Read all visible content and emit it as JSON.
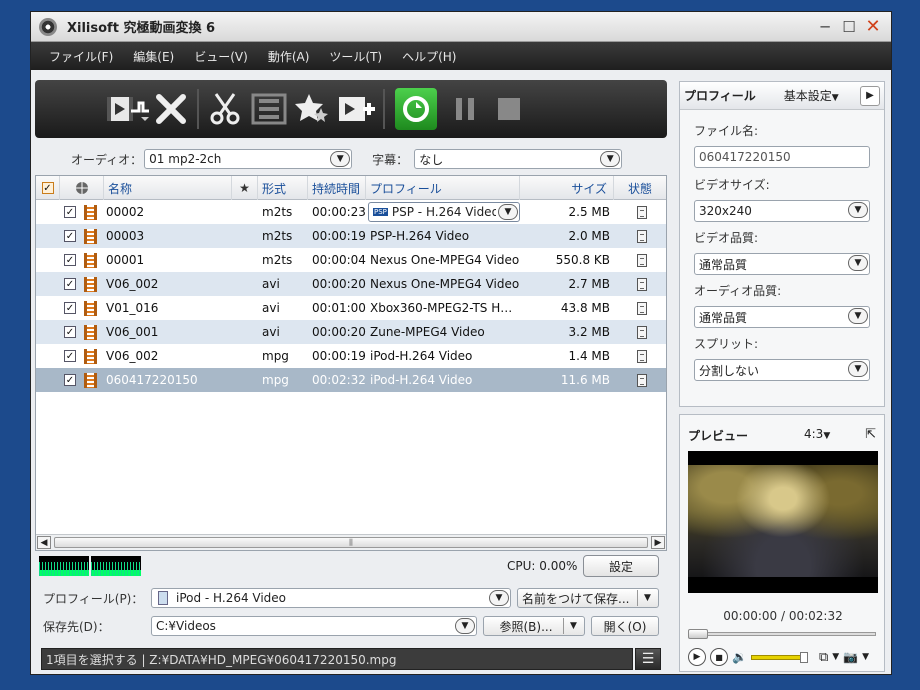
{
  "window": {
    "title": "Xilisoft 究極動画変換 6",
    "buttons": {
      "minimize": "─",
      "maximize": "☐",
      "close": "✕"
    }
  },
  "menu": [
    "ファイル(F)",
    "編集(E)",
    "ビュー(V)",
    "動作(A)",
    "ツール(T)",
    "ヘルプ(H)"
  ],
  "audio": {
    "label": "オーディオ：",
    "value": "01 mp2-2ch"
  },
  "subtitle": {
    "label": "字幕：",
    "value": "なし"
  },
  "grid": {
    "headers": {
      "name": "名称",
      "star": "★",
      "format": "形式",
      "duration": "持続時間",
      "profile": "プロフィール",
      "size": "サイズ",
      "status": "状態"
    },
    "rows": [
      {
        "name": "00002",
        "format": "m2ts",
        "duration": "00:00:23",
        "profile": "PSP - H.264 Video",
        "size": "2.5 MB"
      },
      {
        "name": "00003",
        "format": "m2ts",
        "duration": "00:00:19",
        "profile": "PSP-H.264 Video",
        "size": "2.0 MB"
      },
      {
        "name": "00001",
        "format": "m2ts",
        "duration": "00:00:04",
        "profile": "Nexus One-MPEG4 Video",
        "size": "550.8 KB"
      },
      {
        "name": "V06_002",
        "format": "avi",
        "duration": "00:00:20",
        "profile": "Nexus One-MPEG4 Video",
        "size": "2.7 MB"
      },
      {
        "name": "V01_016",
        "format": "avi",
        "duration": "00:01:00",
        "profile": "Xbox360-MPEG2-TS H…",
        "size": "43.8 MB"
      },
      {
        "name": "V06_001",
        "format": "avi",
        "duration": "00:00:20",
        "profile": "Zune-MPEG4 Video",
        "size": "3.2 MB"
      },
      {
        "name": "V06_002",
        "format": "mpg",
        "duration": "00:00:19",
        "profile": "iPod-H.264 Video",
        "size": "1.4 MB"
      },
      {
        "name": "060417220150",
        "format": "mpg",
        "duration": "00:02:32",
        "profile": "iPod-H.264 Video",
        "size": "11.6 MB"
      }
    ],
    "psp_badge": "PSP"
  },
  "cpu": {
    "text": "CPU: 0.00%",
    "settings_label": "設定"
  },
  "profile_row": {
    "label": "プロフィール(P)：",
    "value": "iPod - H.264 Video",
    "save_label": "名前をつけて保存..."
  },
  "dest_row": {
    "label": "保存先(D)：",
    "value": "C:¥Videos",
    "browse_label": "参照(B)...",
    "open_label": "開く(O)"
  },
  "status": {
    "text": "1項目を選択する | Z:¥DATA¥HD_MPEG¥060417220150.mpg"
  },
  "profile_panel": {
    "title": "プロフィール",
    "mode": "基本設定",
    "filename_label": "ファイル名:",
    "filename_value": "060417220150",
    "video_size_label": "ビデオサイズ:",
    "video_size_value": "320x240",
    "video_quality_label": "ビデオ品質:",
    "video_quality_value": "通常品質",
    "audio_quality_label": "オーディオ品質:",
    "audio_quality_value": "通常品質",
    "split_label": "スプリット:",
    "split_value": "分割しない"
  },
  "preview": {
    "title": "プレビュー",
    "ratio": "4:3",
    "time": "00:00:00 / 00:02:32"
  }
}
